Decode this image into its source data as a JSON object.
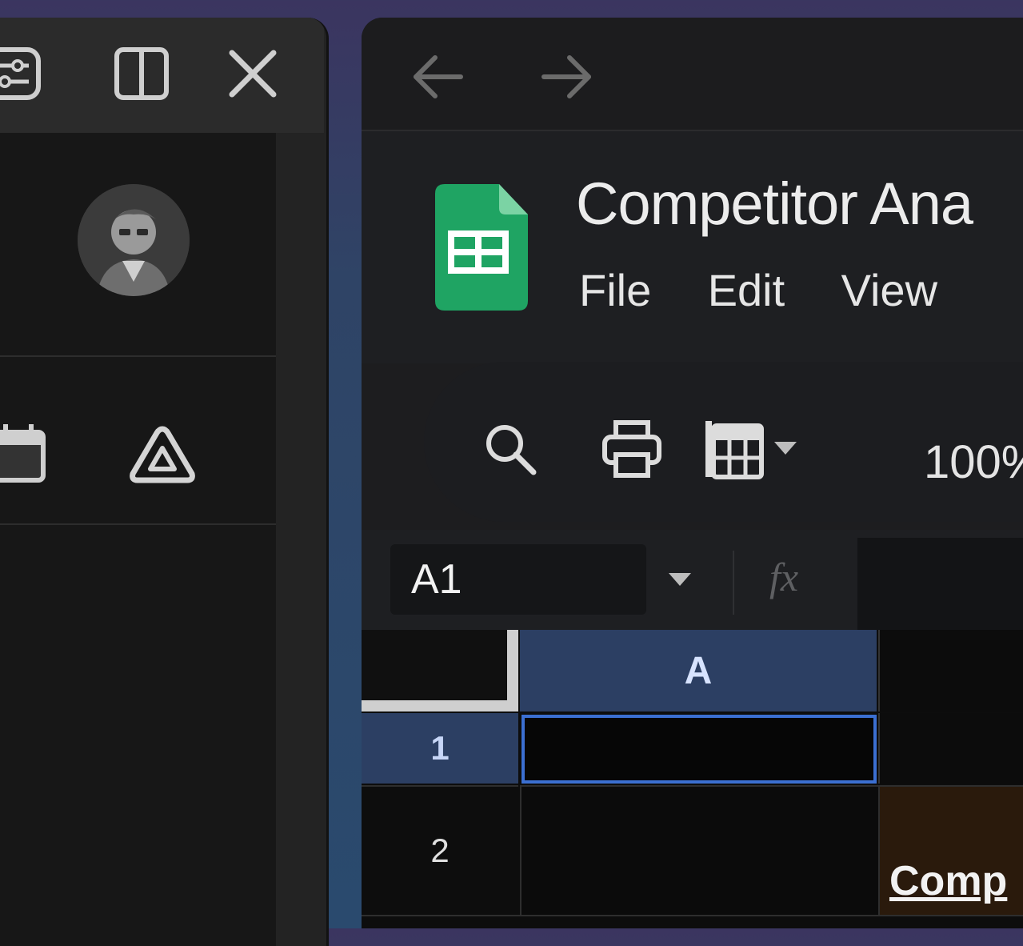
{
  "left_panel": {
    "titlebar_buttons": [
      "sliders-icon",
      "split-view-icon",
      "close-icon"
    ],
    "apps": [
      "calendar-icon",
      "drive-icon"
    ]
  },
  "sheet": {
    "title": "Competitor Ana",
    "menu": [
      "File",
      "Edit",
      "View"
    ],
    "toolbar": {
      "zoom": "100%",
      "icons": [
        "search-icon",
        "print-icon",
        "format-painter-icon"
      ]
    },
    "name_box": "A1",
    "formula_icon": "fx",
    "grid": {
      "columns": [
        "A"
      ],
      "rows": [
        "1",
        "2"
      ],
      "cell_b2": "Comp"
    }
  },
  "colors": {
    "selection_header": "#2c3f63",
    "selection_border": "#3b6fd1",
    "sheets_green": "#1fa463",
    "cell_b2_fill": "#2a1a0c"
  }
}
